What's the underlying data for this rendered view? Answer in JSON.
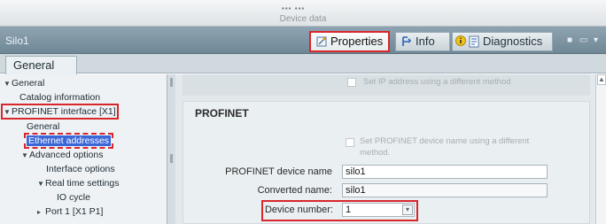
{
  "window": {
    "handle": "▪▪▪ ▪▪▪",
    "title": "Device data",
    "object_name": "Silo1"
  },
  "tabs": {
    "properties": "Properties",
    "info": "Info",
    "diagnostics": "Diagnostics"
  },
  "subtabs": {
    "general": "General"
  },
  "tree": {
    "general": "General",
    "catalog_information": "Catalog information",
    "profinet_interface": "PROFINET interface [X1]",
    "general_sub": "General",
    "ethernet_addresses": "Ethernet addresses",
    "advanced_options": "Advanced options",
    "interface_options": "Interface options",
    "real_time_settings": "Real time settings",
    "io_cycle": "IO cycle",
    "port1": "Port 1 [X1 P1]"
  },
  "content": {
    "set_ip_different": "Set IP address using a different method",
    "section_title": "PROFINET",
    "set_name_different_line1": "Set PROFINET device name using a different",
    "set_name_different_line2": "method.",
    "device_name_label": "PROFINET device name",
    "device_name_value": "silo1",
    "converted_name_label": "Converted name:",
    "converted_name_value": "silo1",
    "device_number_label": "Device number:",
    "device_number_value": "1"
  },
  "colors": {
    "highlight_red": "#d9262b",
    "selection_blue": "#3a66d8",
    "title_bar": "#7b92a1"
  }
}
